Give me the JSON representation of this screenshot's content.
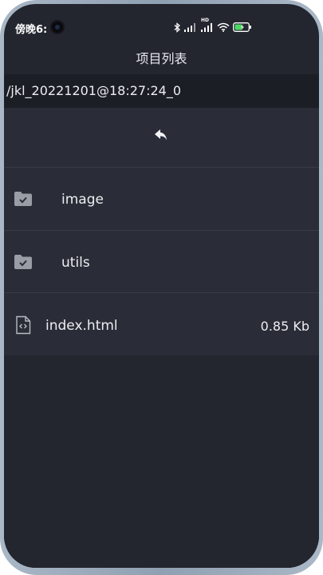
{
  "status_bar": {
    "time": "傍晚6:",
    "icons": [
      "bluetooth-icon",
      "cellular-signal-icon",
      "hd-signal-icon",
      "wifi-icon",
      "battery-icon"
    ],
    "hd_label": "HD"
  },
  "header": {
    "title": "项目列表"
  },
  "path": {
    "current": "/jkl_20221201@18:27:24_0"
  },
  "list": {
    "back_icon": "back-arrow-icon",
    "items": [
      {
        "type": "folder",
        "name": "image",
        "icon": "folder-check-icon"
      },
      {
        "type": "folder",
        "name": "utils",
        "icon": "folder-check-icon"
      },
      {
        "type": "file",
        "name": "index.html",
        "size": "0.85 Kb",
        "icon": "code-file-icon"
      }
    ]
  },
  "colors": {
    "screen_bg": "#23252f",
    "list_bg": "#2a2c37",
    "path_bg": "#1c1e26",
    "battery_accent": "#4cd964"
  }
}
